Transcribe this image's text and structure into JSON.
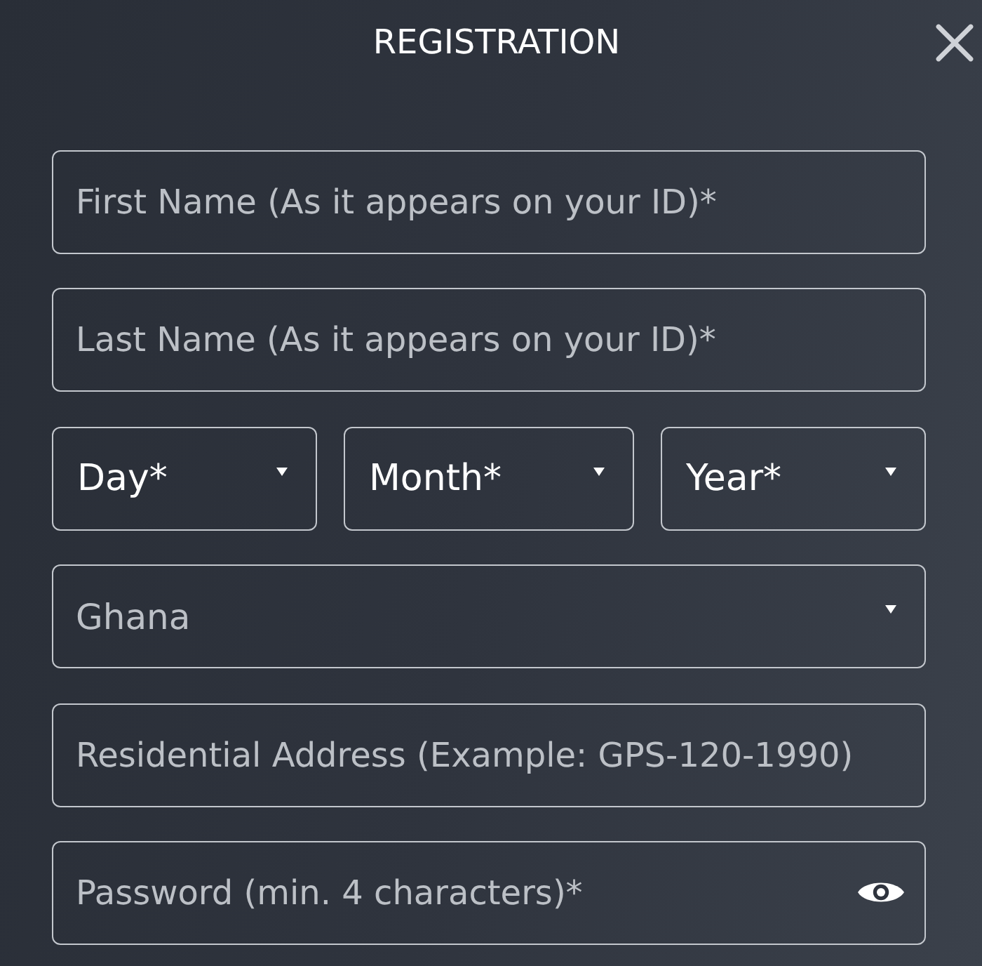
{
  "dialog": {
    "title": "REGISTRATION"
  },
  "fields": [
    {
      "kind": "text",
      "placeholder": "First Name (As it appears on your ID)*"
    },
    {
      "kind": "text",
      "placeholder": "Last Name (As it appears on your ID)*"
    },
    {
      "kind": "date",
      "selects": [
        {
          "label": "Day*"
        },
        {
          "label": "Month*"
        },
        {
          "label": "Year*"
        }
      ]
    },
    {
      "kind": "select",
      "value": "Ghana"
    },
    {
      "kind": "text",
      "placeholder": "Residential Address (Example: GPS-120-1990)"
    },
    {
      "kind": "password",
      "placeholder": "Password (min. 4 characters)*"
    }
  ]
}
